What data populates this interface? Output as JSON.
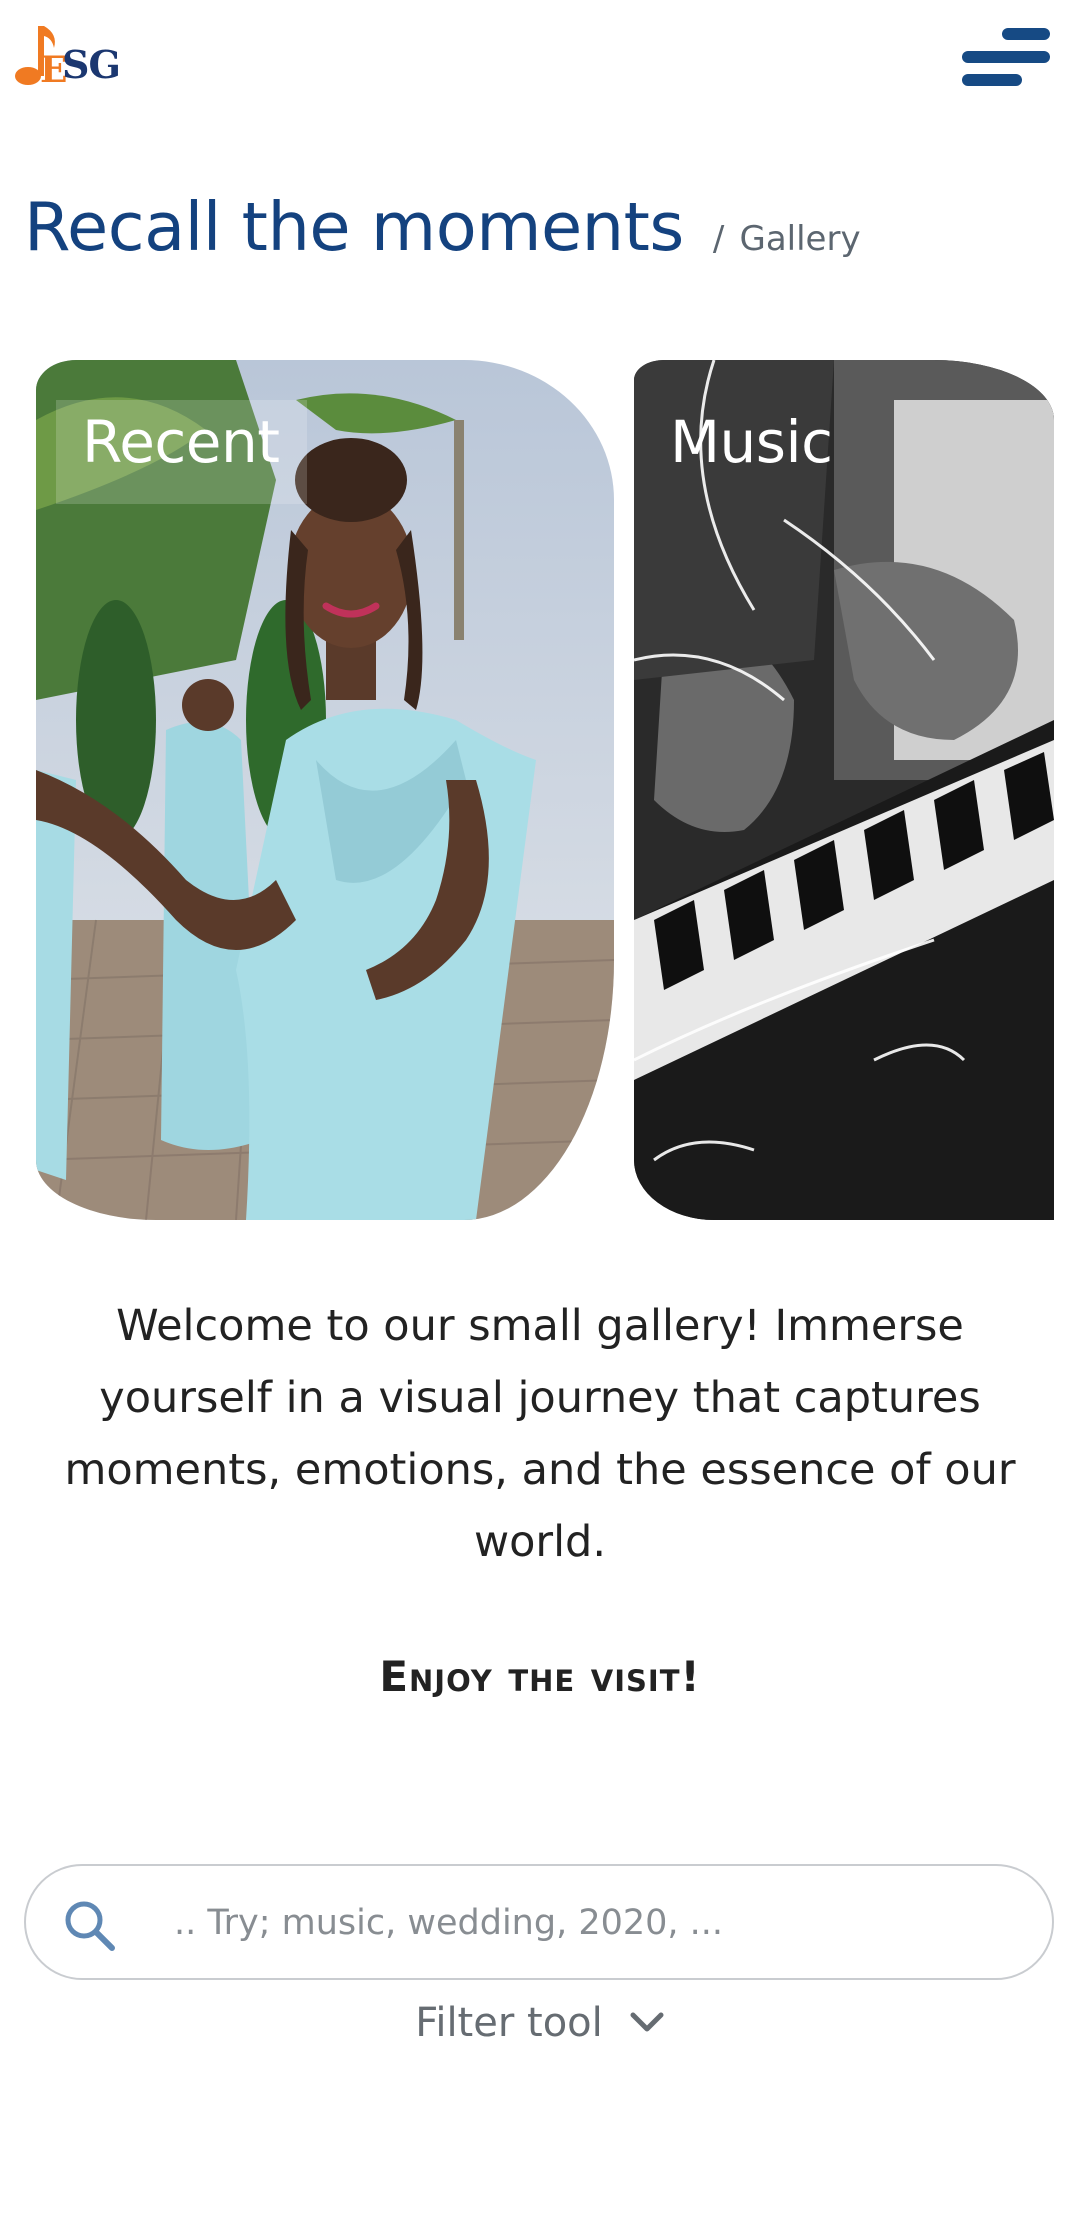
{
  "header": {
    "logo_text": "SG",
    "logo_alt": "ESG",
    "menu_icon": "hamburger-menu-icon"
  },
  "page": {
    "title": "Recall the moments",
    "breadcrumb_separator": "/",
    "breadcrumb": "Gallery"
  },
  "cards": [
    {
      "label": "Recent"
    },
    {
      "label": "Music"
    }
  ],
  "intro": {
    "text": "Welcome to our small gallery! Immerse yourself in a visual journey that captures moments, emotions, and the essence of our world.",
    "cta": "Enjoy the visit!"
  },
  "search": {
    "placeholder": ".. Try; music, wedding, 2020, ...",
    "value": "",
    "icon": "search-icon"
  },
  "filter": {
    "label": "Filter tool",
    "icon": "chevron-down-icon"
  },
  "colors": {
    "brand_blue": "#14427f",
    "logo_orange": "#f07a22",
    "text": "#222222",
    "muted": "#5c6670"
  }
}
